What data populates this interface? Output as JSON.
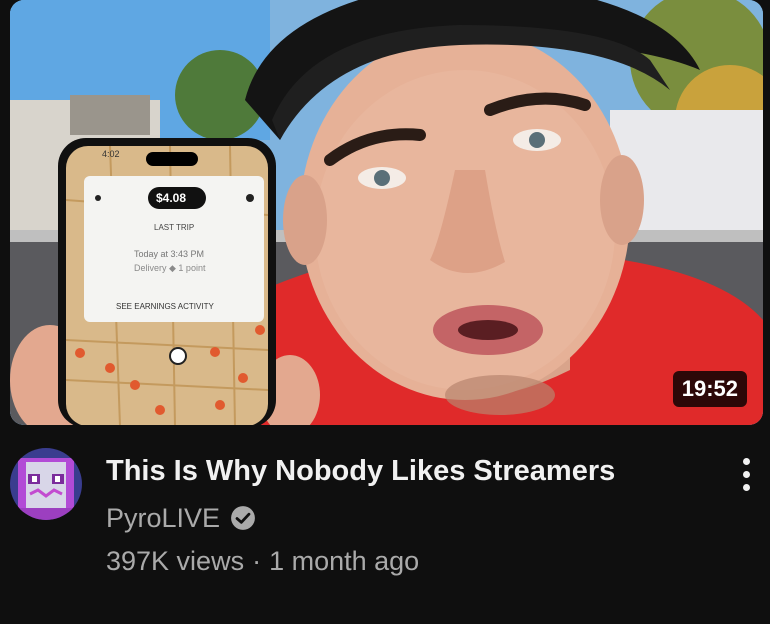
{
  "video": {
    "duration": "19:52",
    "title": "This Is Why Nobody Likes Streamers",
    "channel": "PyroLIVE",
    "views": "397K views",
    "separator": "·",
    "age": "1 month ago"
  },
  "thumbnail_phone": {
    "time": "4:02",
    "amount": "$4.08",
    "label": "LAST TRIP",
    "trip_time": "Today at 3:43 PM",
    "trip_detail": "Delivery ◆ 1 point",
    "link": "SEE EARNINGS ACTIVITY"
  },
  "icons": {
    "verified": "verified-check-icon",
    "more": "more-vertical-icon"
  },
  "colors": {
    "background": "#0f0f0f",
    "title": "#f1f1f1",
    "secondary": "#aaaaaa"
  }
}
